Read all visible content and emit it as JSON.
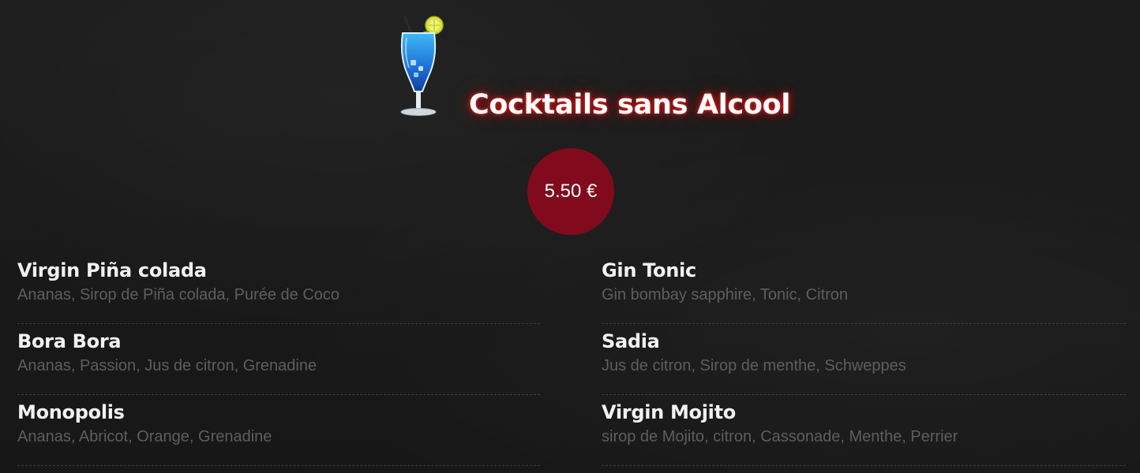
{
  "header": {
    "icon": "cocktail-glass-icon",
    "title": "Cocktails sans Alcool",
    "price": "5.50 €"
  },
  "colors": {
    "background": "#1a1a1a",
    "price_badge": "#820a1d",
    "title_glow": "#e01414",
    "item_name": "#f2f2f2",
    "item_description": "#5e5e5e"
  },
  "items": [
    {
      "name": "Virgin Piña colada",
      "description": "Ananas, Sirop de Piña colada, Purée de Coco"
    },
    {
      "name": "Gin Tonic",
      "description": "Gin bombay sapphire, Tonic, Citron"
    },
    {
      "name": "Bora Bora",
      "description": "Ananas, Passion, Jus de citron, Grenadine"
    },
    {
      "name": "Sadia",
      "description": "Jus de citron, Sirop de menthe, Schweppes"
    },
    {
      "name": "Monopolis",
      "description": "Ananas, Abricot, Orange, Grenadine"
    },
    {
      "name": "Virgin Mojito",
      "description": "sirop de Mojito, citron, Cassonade, Menthe, Perrier"
    }
  ]
}
